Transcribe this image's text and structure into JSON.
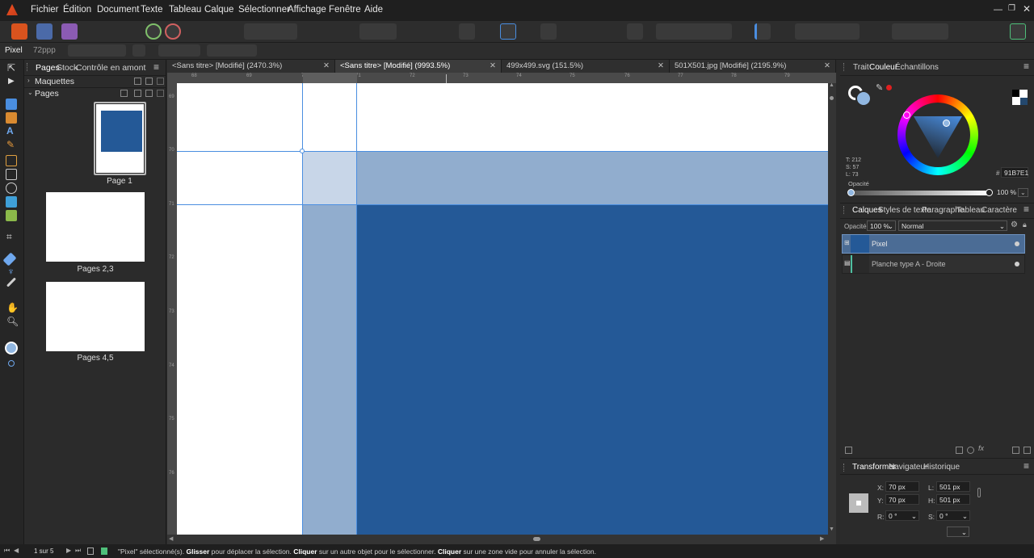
{
  "app": {
    "name": "Affinity Publisher"
  },
  "menu": [
    "Fichier",
    "Édition",
    "Document",
    "Texte",
    "Tableau",
    "Calque",
    "Sélectionner",
    "Affichage",
    "Fenêtre",
    "Aide"
  ],
  "context": {
    "tool": "Pixel",
    "dpi": "72ppp"
  },
  "pages_panel": {
    "tabs": [
      "Pages",
      "Stock",
      "Contrôle en amont"
    ],
    "masters_label": "Maquettes",
    "pages_label": "Pages",
    "thumbnails": [
      "Page 1",
      "Pages 2,3",
      "Pages 4,5"
    ]
  },
  "doc_tabs": [
    {
      "label": "<Sans titre> [Modifié] (2470.3%)",
      "active": false
    },
    {
      "label": "<Sans titre> [Modifié] (9993.5%)",
      "active": true
    },
    {
      "label": "499x499.svg (151.5%)",
      "active": false
    },
    {
      "label": "501X501.jpg [Modifié] (2195.9%)",
      "active": false
    }
  ],
  "ruler": {
    "h": [
      "68",
      "69",
      "70",
      "71",
      "72",
      "73",
      "74",
      "75",
      "76",
      "77",
      "78",
      "79"
    ],
    "v": [
      "69",
      "70",
      "71",
      "72",
      "73",
      "74",
      "75",
      "76"
    ]
  },
  "color_panel": {
    "tabs": [
      "Trait",
      "Couleur",
      "Échantillons"
    ],
    "hsl": [
      "T: 212",
      "S: 57",
      "L: 73"
    ],
    "hex_prefix": "#",
    "hex": "91B7E1",
    "opacity_label": "Opacité",
    "opacity_value": "100 %"
  },
  "layers_panel": {
    "tabs": [
      "Calques",
      "Styles de texte",
      "Paragraphe",
      "Tableau",
      "Caractère"
    ],
    "opacity_label": "Opacité",
    "opacity_value": "100 %",
    "blend_mode": "Normal",
    "layers": [
      "Pixel",
      "Planche type A - Droite"
    ]
  },
  "transform_panel": {
    "tabs": [
      "Transformer",
      "Navigateur",
      "Historique"
    ],
    "x_label": "X:",
    "x": "70 px",
    "y_label": "Y:",
    "y": "70 px",
    "w_label": "L:",
    "w": "501 px",
    "h_label": "H:",
    "h": "501 px",
    "r_label": "R:",
    "r": "0 °",
    "s_label": "S:",
    "s": "0 °"
  },
  "status": {
    "page_count": "1 sur 5",
    "segments": [
      {
        "t": "\"Pixel\" sélectionné(s). ",
        "b": false
      },
      {
        "t": "Glisser",
        "b": true
      },
      {
        "t": " pour déplacer la sélection. ",
        "b": false
      },
      {
        "t": "Cliquer",
        "b": true
      },
      {
        "t": " sur un autre objet pour le sélectionner. ",
        "b": false
      },
      {
        "t": "Cliquer",
        "b": true
      },
      {
        "t": " sur une zone vide pour annuler la sélection.",
        "b": false
      }
    ]
  },
  "colors": {
    "pixel_fill": "#245997",
    "selection_tint": "#91B7E1",
    "accent": "#4a8ee0"
  }
}
